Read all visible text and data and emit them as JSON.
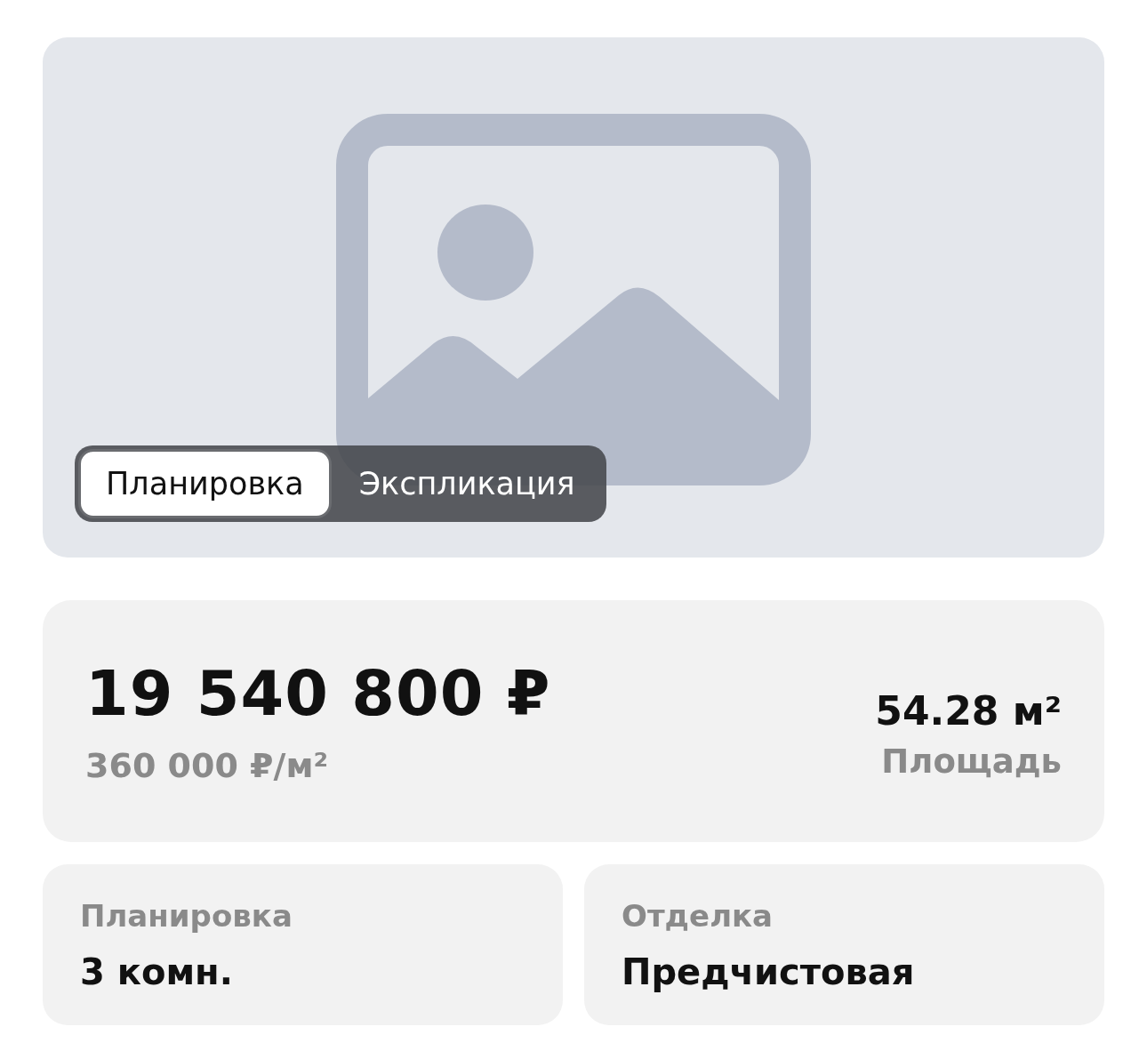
{
  "gallery": {
    "tabs": [
      {
        "label": "Планировка",
        "selected": true
      },
      {
        "label": "Экспликация",
        "selected": false
      }
    ]
  },
  "price": {
    "total": "19 540 800 ₽",
    "per_meter": "360 000 ₽/м²",
    "area": "54.28 м²",
    "area_label": "Площадь"
  },
  "details": [
    {
      "label": "Планировка",
      "value": "3 комн."
    },
    {
      "label": "Отделка",
      "value": "Предчистовая"
    }
  ]
}
